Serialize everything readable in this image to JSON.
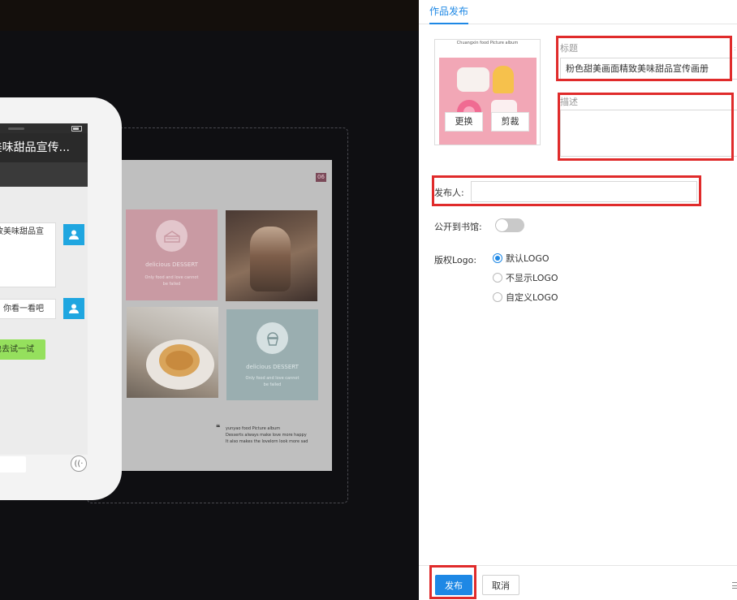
{
  "stage": {
    "page_number": "06",
    "tile_pink": {
      "title": "delicious DESSERT",
      "sub": "Only food and love cannot be failed"
    },
    "tile_blue": {
      "title": "delicious DESSERT",
      "sub": "Only food and love cannot be failed"
    },
    "quote_lines": "yunyao food Picture album\nDesserts always make love more happy\nIt also makes the lovelorn look more sad"
  },
  "phone": {
    "header_title": "精致美味甜品宣传...",
    "bubble1_text": "画面精致美味甜品宣",
    "bubble2_text": "你看一看吧",
    "green_button": "也去试一试"
  },
  "panel": {
    "tab_label": "作品发布",
    "cover_caption": "Chuangxin food Picture album",
    "replace_label": "更换",
    "crop_label": "剪裁",
    "title_label": "标题",
    "title_value": "粉色甜美画面精致美味甜品宣传画册",
    "desc_label": "描述",
    "publisher_label": "发布人:",
    "library_label": "公开到书馆:",
    "logo_label": "版权Logo:",
    "logo_options": [
      "默认LOGO",
      "不显示LOGO",
      "自定义LOGO"
    ],
    "submit_label": "发布",
    "cancel_label": "取消"
  },
  "colors": {
    "accent": "#1e88e5",
    "highlight": "#e02b2b",
    "chat_avatar": "#1fa6e0",
    "chat_button": "#95e05d"
  },
  "icons": [
    "cake-icon",
    "cupcake-icon",
    "user-icon",
    "voice-icon",
    "menu-icon"
  ]
}
